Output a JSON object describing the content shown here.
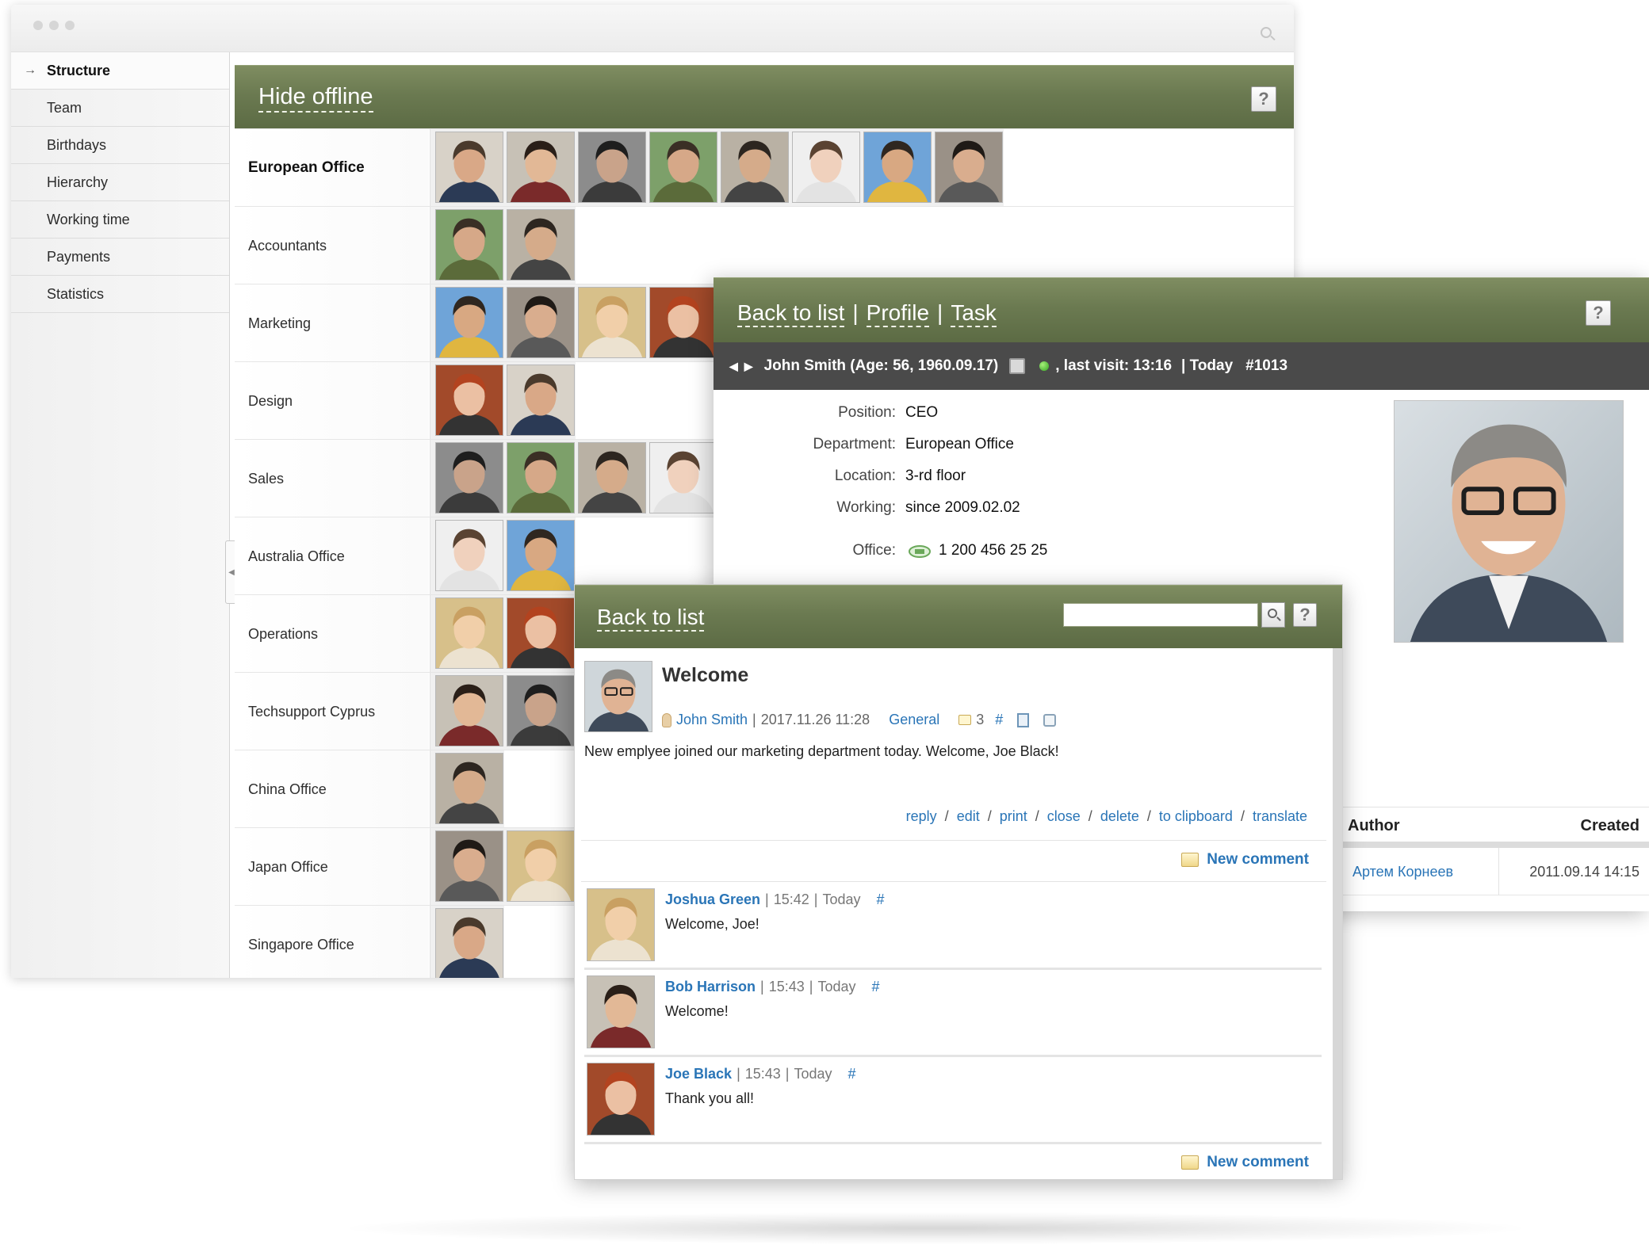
{
  "sidebar": {
    "items": [
      {
        "label": "Structure"
      },
      {
        "label": "Team"
      },
      {
        "label": "Birthdays"
      },
      {
        "label": "Hierarchy"
      },
      {
        "label": "Working time"
      },
      {
        "label": "Payments"
      },
      {
        "label": "Statistics"
      }
    ]
  },
  "structure": {
    "hide_offline": "Hide offline",
    "help": "?",
    "departments": [
      {
        "name": "European Office",
        "photos": 8
      },
      {
        "name": "Accountants",
        "photos": 2
      },
      {
        "name": "Marketing",
        "photos": 4
      },
      {
        "name": "Design",
        "photos": 2
      },
      {
        "name": "Sales",
        "photos": 4
      },
      {
        "name": "Australia Office",
        "photos": 2
      },
      {
        "name": "Operations",
        "photos": 2
      },
      {
        "name": "Techsupport Cyprus",
        "photos": 2
      },
      {
        "name": "China Office",
        "photos": 1
      },
      {
        "name": "Japan Office",
        "photos": 2
      },
      {
        "name": "Singapore Office",
        "photos": 1
      }
    ]
  },
  "profile": {
    "back_to_list": "Back to list",
    "separator": "|",
    "profile_link": "Profile",
    "task_link": "Task",
    "help": "?",
    "info_bar": {
      "name": "John Smith (Age: 56, 1960.09.17)",
      "last_visit": ", last visit: 13:16",
      "today": "| Today",
      "id": "#1013"
    },
    "fields": [
      {
        "label": "Position:",
        "value": "CEO"
      },
      {
        "label": "Department:",
        "value": "European Office"
      },
      {
        "label": "Location:",
        "value": "3-rd floor"
      },
      {
        "label": "Working:",
        "value": "since 2009.02.02"
      }
    ],
    "office_label": "Office:",
    "office_phone": "1 200 456 25 25",
    "table": {
      "author_header": "Author",
      "created_header": "Created",
      "author": "Артем Корнеев",
      "created": "2011.09.14 14:15"
    }
  },
  "forum": {
    "back_to_list": "Back to list",
    "search_value": "",
    "help": "?",
    "post": {
      "title": "Welcome",
      "author": "John Smith",
      "meta_sep": "|",
      "datetime": "2017.11.26 11:28",
      "category": "General",
      "comments_count": "3",
      "hash": "#",
      "text": "New emplyee joined our marketing department today. Welcome, Joe Black!"
    },
    "actions": [
      {
        "label": "reply"
      },
      {
        "label": "edit"
      },
      {
        "label": "print"
      },
      {
        "label": "close"
      },
      {
        "label": "delete"
      },
      {
        "label": "to clipboard"
      },
      {
        "label": "translate"
      }
    ],
    "action_sep": "/",
    "new_comment": "New comment",
    "comments": [
      {
        "author": "Joshua Green",
        "time": "15:42",
        "day": "Today",
        "hash": "#",
        "text": "Welcome, Joe!"
      },
      {
        "author": "Bob Harrison",
        "time": "15:43",
        "day": "Today",
        "hash": "#",
        "text": "Welcome!"
      },
      {
        "author": "Joe Black",
        "time": "15:43",
        "day": "Today",
        "hash": "#",
        "text": "Thank you all!"
      }
    ]
  },
  "colors": {
    "header_green": "#6b7a51",
    "link_blue": "#2a75b7",
    "info_bar": "#4a4a4a"
  }
}
